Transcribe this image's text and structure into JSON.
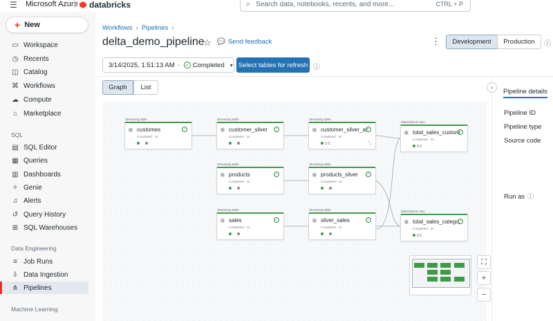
{
  "topbar": {
    "brand_ms": "Microsoft Azure",
    "brand_db": "databricks",
    "search_placeholder": "Search data, notebooks, recents, and more...",
    "search_shortcut": "CTRL + P"
  },
  "sidebar": {
    "new_label": "New",
    "items": [
      {
        "label": "Workspace",
        "icon": "folder-icon"
      },
      {
        "label": "Recents",
        "icon": "clock-icon"
      },
      {
        "label": "Catalog",
        "icon": "catalog-icon"
      },
      {
        "label": "Workflows",
        "icon": "workflows-icon"
      },
      {
        "label": "Compute",
        "icon": "cloud-icon"
      },
      {
        "label": "Marketplace",
        "icon": "store-icon"
      }
    ],
    "sql_heading": "SQL",
    "sql_items": [
      {
        "label": "SQL Editor",
        "icon": "sql-editor-icon"
      },
      {
        "label": "Queries",
        "icon": "query-icon"
      },
      {
        "label": "Dashboards",
        "icon": "dashboard-icon"
      },
      {
        "label": "Genie",
        "icon": "genie-icon"
      },
      {
        "label": "Alerts",
        "icon": "bell-icon"
      },
      {
        "label": "Query History",
        "icon": "history-icon"
      },
      {
        "label": "SQL Warehouses",
        "icon": "warehouse-icon"
      }
    ],
    "de_heading": "Data Engineering",
    "de_items": [
      {
        "label": "Job Runs",
        "icon": "job-runs-icon"
      },
      {
        "label": "Data Ingestion",
        "icon": "ingest-icon"
      },
      {
        "label": "Pipelines",
        "icon": "pipelines-icon",
        "active": true
      }
    ],
    "ml_heading": "Machine Learning"
  },
  "header": {
    "breadcrumb": [
      "Workflows",
      "Pipelines"
    ],
    "title": "delta_demo_pipeline",
    "feedback": "Send feedback",
    "mode_dev": "Development",
    "mode_prod": "Production"
  },
  "run": {
    "timestamp": "3/14/2025, 1:51:13 AM",
    "status": "Completed",
    "refresh_button": "Select tables for refresh"
  },
  "view_tabs": {
    "graph": "Graph",
    "list": "List"
  },
  "graph": {
    "nodes": [
      {
        "kind": "Streaming table",
        "name": "customes",
        "status": "Completed · 1s",
        "metric": "·"
      },
      {
        "kind": "Streaming table",
        "name": "customer_silver",
        "status": "Completed · 1s",
        "metric": "·"
      },
      {
        "kind": "Streaming table",
        "name": "customer_silver_ac...",
        "status": "Completed · 3s",
        "metric": "1  0"
      },
      {
        "kind": "Materialized view",
        "name": "total_sales_custom...",
        "status": "Completed · 3s",
        "metric": "4  0"
      },
      {
        "kind": "Streaming table",
        "name": "products",
        "status": "Completed · 1s",
        "metric": "·"
      },
      {
        "kind": "Streaming table",
        "name": "products_silver",
        "status": "Completed · 1s",
        "metric": "·"
      },
      {
        "kind": "Streaming table",
        "name": "sales",
        "status": "Completed · 1s",
        "metric": "·"
      },
      {
        "kind": "Streaming table",
        "name": "silver_sales",
        "status": "Completed · 1s",
        "metric": "·"
      },
      {
        "kind": "Materialized view",
        "name": "total_sales_catego...",
        "status": "Completed · 3s",
        "metric": "2  0"
      }
    ]
  },
  "details": {
    "title": "Pipeline details",
    "pipeline_id": "Pipeline ID",
    "pipeline_type": "Pipeline type",
    "source_code": "Source code",
    "run_as": "Run as"
  }
}
